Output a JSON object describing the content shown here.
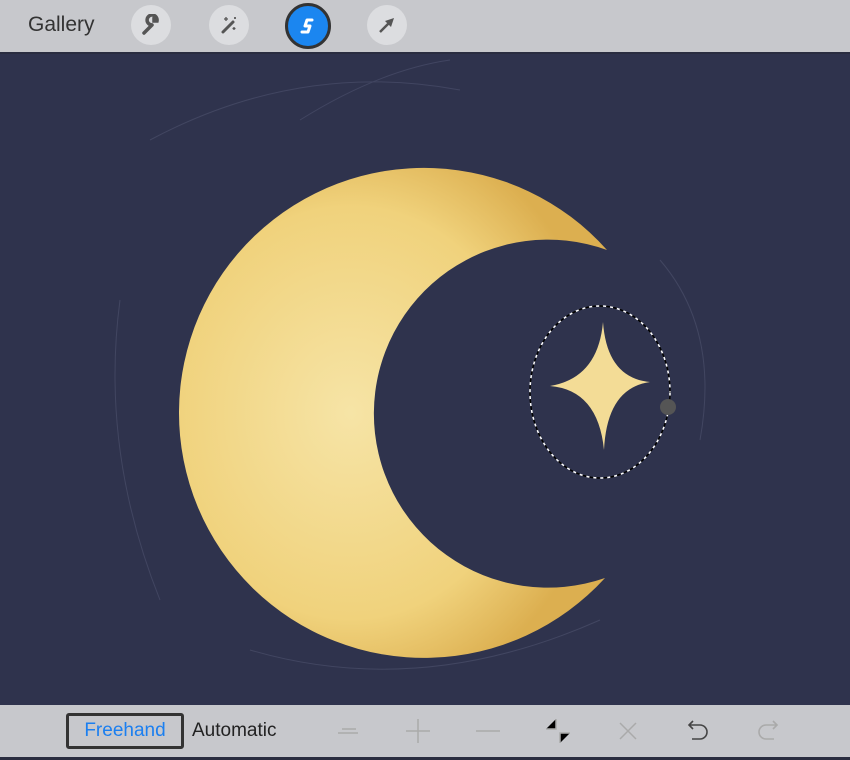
{
  "topbar": {
    "gallery_label": "Gallery",
    "tools": [
      {
        "name": "actions",
        "icon": "wrench-icon"
      },
      {
        "name": "adjustments",
        "icon": "magic-wand-icon"
      },
      {
        "name": "selection",
        "icon": "selection-s-icon",
        "active": true
      },
      {
        "name": "transform",
        "icon": "arrow-cursor-icon"
      }
    ]
  },
  "selection_toolbar": {
    "modes": [
      "Freehand",
      "Automatic"
    ],
    "selected_mode": "Freehand",
    "accent": "#1b7ff0"
  },
  "colors": {
    "canvas": "#2f334d",
    "moon": "#f0d27c",
    "toolbar": "#c7c8cc"
  }
}
